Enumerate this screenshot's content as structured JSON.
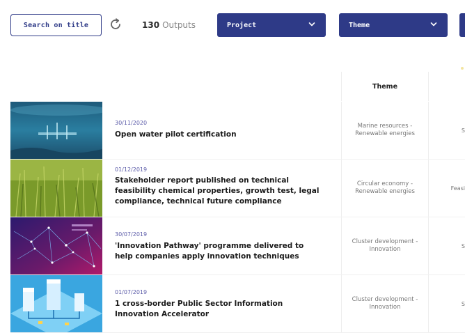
{
  "toolbar": {
    "search_label": "Search on title",
    "outputs_count": "130",
    "outputs_label": "Outputs",
    "project_label": "Project",
    "theme_label": "Theme",
    "refresh_icon": "refresh-icon",
    "chevron_icon": "chevron-down-icon",
    "accent_color": "#2e3a87"
  },
  "table": {
    "theme_header": "Theme"
  },
  "rows": [
    {
      "date": "30/11/2020",
      "title_lines": [
        "Open water pilot certification"
      ],
      "theme_lines": [
        "Marine resources -",
        "Renewable energies"
      ],
      "next_col": "S"
    },
    {
      "date": "01/12/2019",
      "title_lines": [
        "Stakeholder report published on technical",
        "feasibility chemical properties, growth test, legal",
        "compliance, technical future compliance"
      ],
      "theme_lines": [
        "Circular economy -",
        "Renewable energies"
      ],
      "next_col": "Feasi"
    },
    {
      "date": "30/07/2019",
      "title_lines": [
        "'Innovation Pathway' programme delivered to",
        "help companies apply innovation techniques"
      ],
      "theme_lines": [
        "Cluster development -",
        "Innovation"
      ],
      "next_col": "S"
    },
    {
      "date": "01/07/2019",
      "title_lines": [
        "1 cross-border Public Sector Information",
        "Innovation Accelerator"
      ],
      "theme_lines": [
        "Cluster development -",
        "Innovation"
      ],
      "next_col": "S"
    }
  ]
}
